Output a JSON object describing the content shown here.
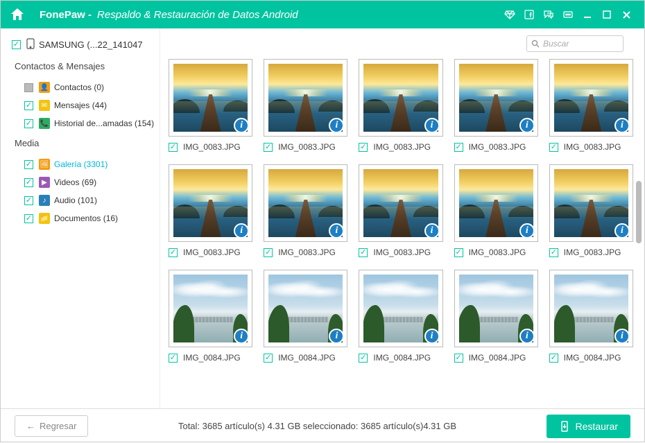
{
  "header": {
    "brand": "FonePaw -",
    "subtitle": "Respaldo & Restauración de Datos Android"
  },
  "device": {
    "name": "SAMSUNG (...22_141047"
  },
  "sections": {
    "contacts_title": "Contactos & Mensajes",
    "media_title": "Media"
  },
  "tree": {
    "contactos": {
      "label": "Contactos (0)"
    },
    "mensajes": {
      "label": "Mensajes (44)"
    },
    "historial": {
      "label": "Historial de...amadas (154)"
    },
    "galeria": {
      "label": "Galería (3301)"
    },
    "videos": {
      "label": "Videos (69)"
    },
    "audio": {
      "label": "Audio (101)"
    },
    "documentos": {
      "label": "Documentos (16)"
    }
  },
  "search": {
    "placeholder": "Buscar"
  },
  "thumbs": [
    {
      "name": "IMG_0083.JPG",
      "kind": "sunset"
    },
    {
      "name": "IMG_0083.JPG",
      "kind": "sunset"
    },
    {
      "name": "IMG_0083.JPG",
      "kind": "sunset"
    },
    {
      "name": "IMG_0083.JPG",
      "kind": "sunset"
    },
    {
      "name": "IMG_0083.JPG",
      "kind": "sunset"
    },
    {
      "name": "IMG_0083.JPG",
      "kind": "sunset"
    },
    {
      "name": "IMG_0083.JPG",
      "kind": "sunset"
    },
    {
      "name": "IMG_0083.JPG",
      "kind": "sunset"
    },
    {
      "name": "IMG_0083.JPG",
      "kind": "sunset"
    },
    {
      "name": "IMG_0083.JPG",
      "kind": "sunset"
    },
    {
      "name": "IMG_0084.JPG",
      "kind": "landscape"
    },
    {
      "name": "IMG_0084.JPG",
      "kind": "landscape"
    },
    {
      "name": "IMG_0084.JPG",
      "kind": "landscape"
    },
    {
      "name": "IMG_0084.JPG",
      "kind": "landscape"
    },
    {
      "name": "IMG_0084.JPG",
      "kind": "landscape"
    }
  ],
  "footer": {
    "back": "Regresar",
    "status": "Total: 3685 artículo(s) 4.31 GB seleccionado: 3685 artículo(s)4.31 GB",
    "restore": "Restaurar"
  }
}
